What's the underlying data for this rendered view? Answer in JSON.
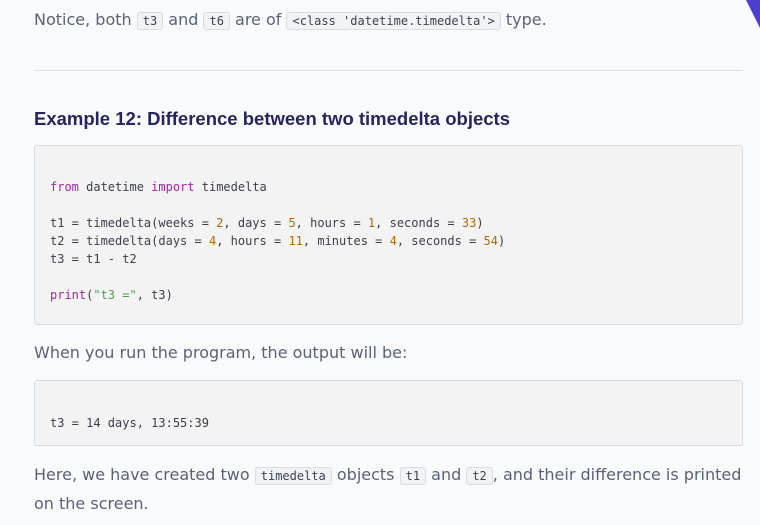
{
  "intro": {
    "text_1": "Notice, both ",
    "code_1": "t3",
    "text_2": " and ",
    "code_2": "t6",
    "text_3": " are of ",
    "code_3": "<class 'datetime.timedelta'>",
    "text_4": " type."
  },
  "example": {
    "title": "Example 12: Difference between two timedelta objects",
    "code": {
      "l1_kw1": "from",
      "l1_mid": " datetime ",
      "l1_kw2": "import",
      "l1_end": " timedelta",
      "l3_a": "t1 = timedelta(weeks = ",
      "l3_n1": "2",
      "l3_b": ", days = ",
      "l3_n2": "5",
      "l3_c": ", hours = ",
      "l3_n3": "1",
      "l3_d": ", seconds = ",
      "l3_n4": "33",
      "l3_e": ")",
      "l4_a": "t2 = timedelta(days = ",
      "l4_n1": "4",
      "l4_b": ", hours = ",
      "l4_n2": "11",
      "l4_c": ", minutes = ",
      "l4_n3": "4",
      "l4_d": ", seconds = ",
      "l4_n4": "54",
      "l4_e": ")",
      "l5": "t3 = t1 - t2",
      "l7_kw": "print",
      "l7_a": "(",
      "l7_str": "\"t3 =\"",
      "l7_b": ", t3)"
    }
  },
  "output_intro": "When you run the program, the output will be:",
  "output": "t3 = 14 days, 13:55:39",
  "explanation": {
    "text_1": "Here, we have created two ",
    "code_1": "timedelta",
    "text_2": " objects ",
    "code_2": "t1",
    "text_3": " and ",
    "code_3": "t2",
    "text_4": ", and their difference is printed on the screen."
  },
  "colors": {
    "heading": "#25265e",
    "body_text": "#5a6278",
    "keyword": "#a626a4",
    "number": "#b76b01",
    "string": "#50a14f",
    "corner_accent": "#4b3fd0"
  }
}
